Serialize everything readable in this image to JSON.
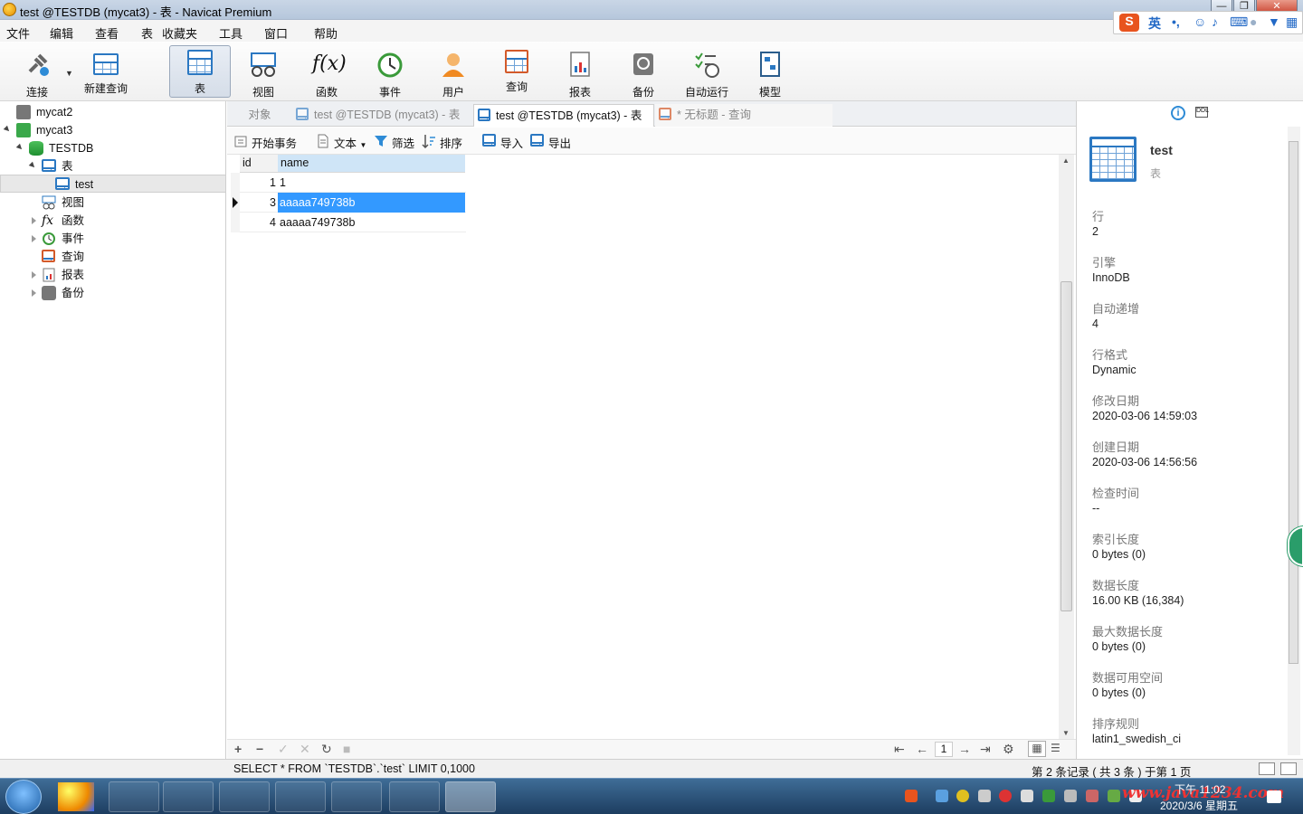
{
  "window": {
    "title": "test @TESTDB (mycat3) - 表 - Navicat Premium"
  },
  "menu": [
    "文件",
    "编辑",
    "查看",
    "表",
    "收藏夹",
    "工具",
    "窗口",
    "帮助"
  ],
  "ime": {
    "lang": "英"
  },
  "toolbar": {
    "items": [
      {
        "label": "连接",
        "icon": "plug-icon"
      },
      {
        "label": "新建查询",
        "icon": "new-query-icon"
      },
      {
        "label": "表",
        "icon": "table-icon",
        "active": true
      },
      {
        "label": "视图",
        "icon": "view-icon"
      },
      {
        "label": "函数",
        "icon": "function-icon",
        "glyph": "f(x)"
      },
      {
        "label": "事件",
        "icon": "clock-icon"
      },
      {
        "label": "用户",
        "icon": "user-icon"
      },
      {
        "label": "查询",
        "icon": "query-icon"
      },
      {
        "label": "报表",
        "icon": "report-icon"
      },
      {
        "label": "备份",
        "icon": "backup-icon"
      },
      {
        "label": "自动运行",
        "icon": "autorun-icon"
      },
      {
        "label": "模型",
        "icon": "model-icon"
      }
    ]
  },
  "tree": [
    {
      "label": "mycat2"
    },
    {
      "label": "mycat3"
    },
    {
      "label": "TESTDB"
    },
    {
      "label": "表"
    },
    {
      "label": "test"
    },
    {
      "label": "视图"
    },
    {
      "label": "函数"
    },
    {
      "label": "事件"
    },
    {
      "label": "查询"
    },
    {
      "label": "报表"
    },
    {
      "label": "备份"
    }
  ],
  "tabs": [
    {
      "label": "对象"
    },
    {
      "label": "test @TESTDB (mycat3) - 表"
    },
    {
      "label": "test @TESTDB (mycat3) - 表"
    },
    {
      "label": "* 无标题 - 查询"
    }
  ],
  "object_toolbar": {
    "begin_tx": "开始事务",
    "text": "文本",
    "filter": "筛选",
    "sort": "排序",
    "import": "导入",
    "export": "导出"
  },
  "grid": {
    "columns": [
      "id",
      "name"
    ],
    "rows": [
      {
        "id": "1",
        "name": "1"
      },
      {
        "id": "3",
        "name": "aaaaa749738b"
      },
      {
        "id": "4",
        "name": "aaaaa749738b"
      }
    ],
    "selected_row": 1
  },
  "grid_footer": {
    "page": "1"
  },
  "info": {
    "name": "test",
    "type": "表",
    "fields": [
      {
        "label": "行",
        "value": "2"
      },
      {
        "label": "引擎",
        "value": "InnoDB"
      },
      {
        "label": "自动递增",
        "value": "4"
      },
      {
        "label": "行格式",
        "value": "Dynamic"
      },
      {
        "label": "修改日期",
        "value": "2020-03-06 14:59:03"
      },
      {
        "label": "创建日期",
        "value": "2020-03-06 14:56:56"
      },
      {
        "label": "检查时间",
        "value": "--"
      },
      {
        "label": "索引长度",
        "value": "0 bytes (0)"
      },
      {
        "label": "数据长度",
        "value": "16.00 KB (16,384)"
      },
      {
        "label": "最大数据长度",
        "value": "0 bytes (0)"
      },
      {
        "label": "数据可用空间",
        "value": "0 bytes (0)"
      },
      {
        "label": "排序规则",
        "value": "latin1_swedish_ci"
      }
    ]
  },
  "status": {
    "sql": "SELECT * FROM `TESTDB`.`test` LIMIT 0,1000",
    "records": "第 2 条记录 ( 共 3 条 ) 于第 1 页"
  },
  "taskbar": {
    "time": "下午 11:02",
    "date": "2020/3/6 星期五",
    "watermark": "www.java1234.com"
  }
}
